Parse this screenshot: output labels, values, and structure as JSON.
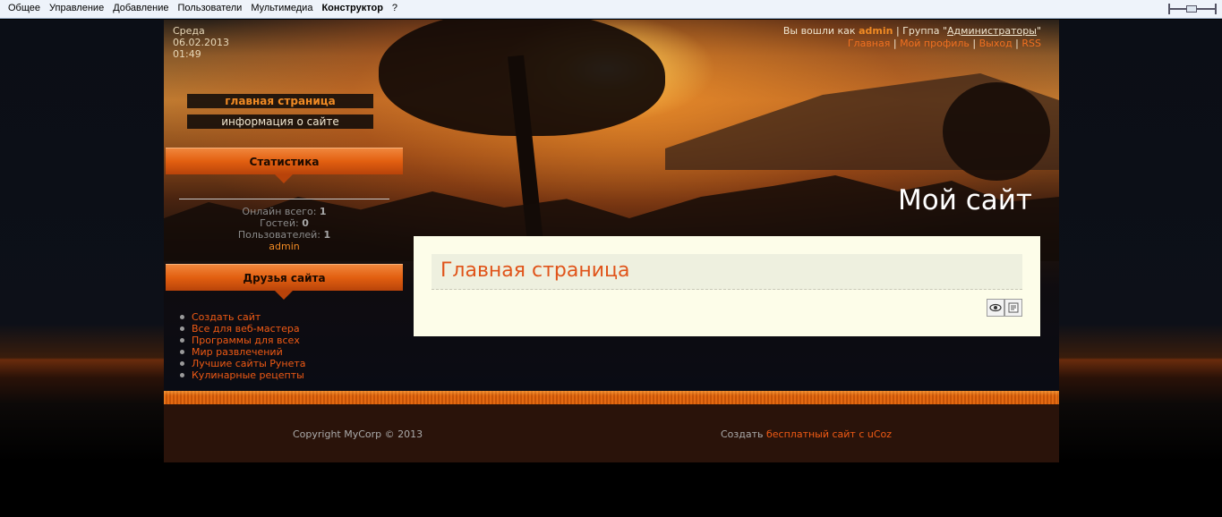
{
  "admin_bar": {
    "menu": [
      "Общее",
      "Управление",
      "Добавление",
      "Пользователи",
      "Мультимедиа",
      "Конструктор",
      "?"
    ]
  },
  "header": {
    "day": "Среда",
    "date": "06.02.2013",
    "time": "01:49",
    "site_title": "Мой сайт"
  },
  "login": {
    "logged_as": "Вы вошли как",
    "username": "admin",
    "group_label": "Группа",
    "group_name": "Администраторы",
    "links": [
      "Главная",
      "Мой профиль",
      "Выход",
      "RSS"
    ]
  },
  "nav": {
    "items": [
      "главная страница",
      "информация о сайте"
    ]
  },
  "stats_block": {
    "title": "Статистика",
    "online_label": "Онлайн всего:",
    "online_value": "1",
    "guests_label": "Гостей:",
    "guests_value": "0",
    "users_label": "Пользователей:",
    "users_value": "1",
    "online_user": "admin"
  },
  "friends_block": {
    "title": "Друзья сайта",
    "links": [
      "Создать сайт",
      "Все для веб-мастера",
      "Программы для всех",
      "Мир развлечений",
      "Лучшие сайты Рунета",
      "Кулинарные рецепты"
    ]
  },
  "content": {
    "title": "Главная страница",
    "icons": [
      "eye-icon",
      "edit-icon"
    ]
  },
  "footer": {
    "copyright": "Copyright MyCorp © 2013",
    "create_prefix": "Создать",
    "create_link": "бесплатный сайт",
    "create_suffix": "с uCoz"
  },
  "colors": {
    "accent": "#f05a14",
    "highlight": "#f08a24",
    "content_bg": "#fdfde9",
    "footer_bg": "#2a130a"
  }
}
